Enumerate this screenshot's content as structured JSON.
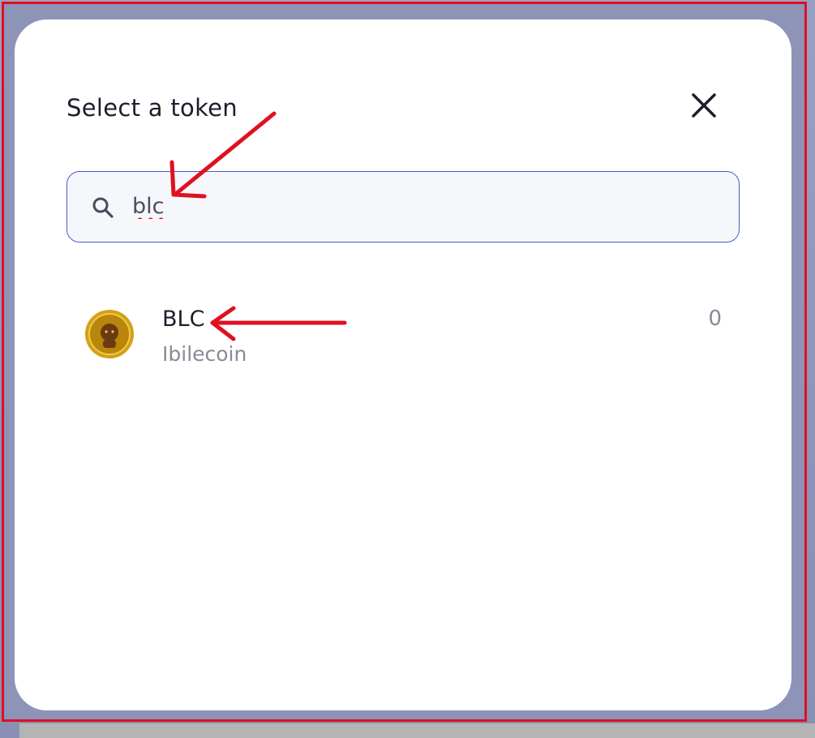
{
  "modal": {
    "title": "Select a token",
    "close_icon": "close-icon"
  },
  "search": {
    "value": "blc",
    "icon": "search-icon"
  },
  "tokens": [
    {
      "symbol": "BLC",
      "name": "Ibilecoin",
      "balance": "0",
      "logo": "ibilecoin-logo"
    }
  ],
  "colors": {
    "backdrop": "#8e93b8",
    "modal_bg": "#ffffff",
    "search_border": "#4a5bd1",
    "search_bg": "#f5f7fb",
    "annotation_red": "#e01020",
    "coin_gold": "#d4a017"
  }
}
